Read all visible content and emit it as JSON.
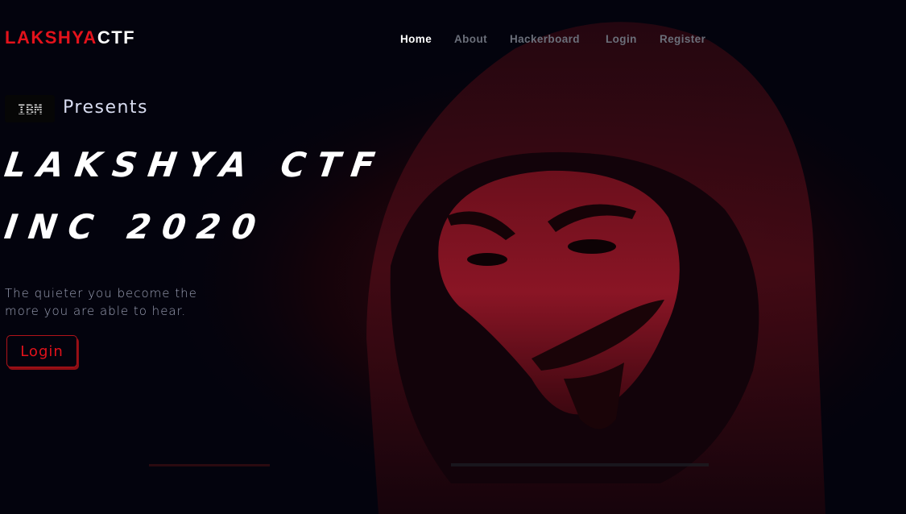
{
  "brand": {
    "part1": "LAKSHYA",
    "part2": "CTF",
    "accent": "#e3121b"
  },
  "nav": {
    "items": [
      {
        "label": "Home",
        "active": true
      },
      {
        "label": "About",
        "active": false
      },
      {
        "label": "Hackerboard",
        "active": false
      },
      {
        "label": "Login",
        "active": false
      },
      {
        "label": "Register",
        "active": false
      }
    ]
  },
  "hero": {
    "sponsor_logo": "IBM",
    "presents": "Presents",
    "headline_line1": "LAKSHYA CTF",
    "headline_line2": "INC 2020",
    "tagline": "The quieter you become the more you are able to hear.",
    "cta_label": "Login",
    "background_icon": "hooded-masked-figure-image"
  },
  "colors": {
    "background": "#03030d",
    "accent": "#e3121b",
    "nav_muted": "#6b6f7a"
  }
}
